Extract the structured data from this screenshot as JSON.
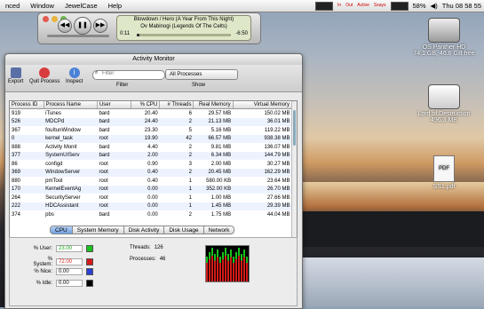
{
  "menubar": {
    "items": [
      "nced",
      "Window",
      "JewelCase",
      "Help"
    ],
    "stats": [
      "In",
      "Out",
      "Active",
      "Ssays"
    ],
    "battery": "58%",
    "clock": "Thu 08 58 55",
    "colors": {
      "gauge_cpu": "#2fd13a",
      "gauge_net": "#d33"
    }
  },
  "itunes": {
    "song": "Blowdown / Hero (A Year From This Night)",
    "album": "Ov Mabinogi (Legends Of The Celts)",
    "elapsed": "0:11",
    "remaining": "-6:50",
    "progress": 0.03
  },
  "desktop": {
    "icons": [
      {
        "label": "OS Panther HD",
        "detail": "74.1 GB, 46.6 GB free"
      },
      {
        "label": "Lord of Destruction",
        "detail": "496.3 MB"
      },
      {
        "label": "SS1.pdf",
        "badge": "PDF"
      }
    ]
  },
  "activity_monitor": {
    "title": "Activity Monitor",
    "toolbar": {
      "export": "Export",
      "quit": "Quit Process",
      "inspect": "Inspect",
      "filter_label": "Filter",
      "filter_placeholder": "Filter",
      "show_label": "Show",
      "show_value": "All Processes"
    },
    "columns": [
      "Process ID",
      "Process Name",
      "User",
      "% CPU",
      "# Threads",
      "Real Memory",
      "Virtual Memory"
    ],
    "rows": [
      [
        "919",
        "iTunes",
        "bard",
        "20.40",
        "6",
        "29.57 MB",
        "150.02 MB"
      ],
      [
        "526",
        "MDCPd",
        "bard",
        "24.40",
        "2",
        "21.13 MB",
        "36.01 MB"
      ],
      [
        "367",
        "fouItunWindow",
        "bard",
        "23.30",
        "5",
        "5.16 MB",
        "119.22 MB"
      ],
      [
        "0",
        "kernel_task",
        "root",
        "19.90",
        "42",
        "66.57 MB",
        "938.38 MB"
      ],
      [
        "888",
        "Activity Monit",
        "bard",
        "4.40",
        "2",
        "9.81 MB",
        "136.07 MB"
      ],
      [
        "377",
        "SystemUIServ",
        "bard",
        "2.00",
        "2",
        "6.34 MB",
        "144.79 MB"
      ],
      [
        "86",
        "configd",
        "root",
        "0.90",
        "3",
        "2.00 MB",
        "30.27 MB"
      ],
      [
        "369",
        "WindowServer",
        "root",
        "0.40",
        "2",
        "20.45 MB",
        "162.29 MB"
      ],
      [
        "880",
        "pmTool",
        "root",
        "0.40",
        "1",
        "580.00 KB",
        "23.64 MB"
      ],
      [
        "170",
        "KernelEventAg",
        "root",
        "0.00",
        "1",
        "352.00 KB",
        "26.70 MB"
      ],
      [
        "264",
        "SecurityServer",
        "root",
        "0.00",
        "1",
        "1.00 MB",
        "27.66 MB"
      ],
      [
        "222",
        "HDCAssistant",
        "root",
        "0.00",
        "1",
        "1.45 MB",
        "29.39 MB"
      ],
      [
        "374",
        "pbs",
        "bard",
        "0.00",
        "2",
        "1.75 MB",
        "44.04 MB"
      ]
    ],
    "tabs": [
      "CPU",
      "System Memory",
      "Disk Activity",
      "Disk Usage",
      "Network"
    ],
    "cpu": {
      "user_label": "% User:",
      "user": "23.00",
      "system_label": "% System:",
      "system": "72.00",
      "nice_label": "% Nice:",
      "nice": "0.00",
      "idle_label": "% Idle:",
      "idle": "0.00",
      "threads_label": "Threads:",
      "threads": "126",
      "processes_label": "Processes:",
      "processes": "46",
      "colors": {
        "user": "#17c31d",
        "system": "#d41a1a",
        "nice": "#2a3fd6",
        "idle": "#000000"
      }
    }
  }
}
